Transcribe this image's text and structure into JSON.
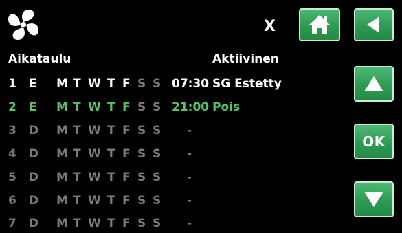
{
  "header": {
    "close_label": "X"
  },
  "icons": {
    "fan": "fan-icon",
    "home": "home-icon",
    "back": "back-arrow-icon",
    "up": "up-arrow-icon",
    "down": "down-arrow-icon"
  },
  "colors": {
    "button_green": "#2f9a53",
    "active_row": "#ffffff",
    "highlight_row": "#56c26a",
    "inactive_row": "#7a7a7a",
    "background": "#000000"
  },
  "schedule": {
    "title": "Aikataulu",
    "active_header": "Aktiivinen",
    "rows": [
      {
        "num": "1",
        "mode": "E",
        "days": [
          "M",
          "T",
          "W",
          "T",
          "F",
          "S",
          "S"
        ],
        "time": "07:30",
        "status": "SG Estetty"
      },
      {
        "num": "2",
        "mode": "E",
        "days": [
          "M",
          "T",
          "W",
          "T",
          "F",
          "S",
          "S"
        ],
        "time": "21:00",
        "status": "Pois"
      },
      {
        "num": "3",
        "mode": "D",
        "days": [
          "M",
          "T",
          "W",
          "T",
          "F",
          "S",
          "S"
        ],
        "dash": "-"
      },
      {
        "num": "4",
        "mode": "D",
        "days": [
          "M",
          "T",
          "W",
          "T",
          "F",
          "S",
          "S"
        ],
        "dash": "-"
      },
      {
        "num": "5",
        "mode": "D",
        "days": [
          "M",
          "T",
          "W",
          "T",
          "F",
          "S",
          "S"
        ],
        "dash": "-"
      },
      {
        "num": "6",
        "mode": "D",
        "days": [
          "M",
          "T",
          "W",
          "T",
          "F",
          "S",
          "S"
        ],
        "dash": "-"
      },
      {
        "num": "7",
        "mode": "D",
        "days": [
          "M",
          "T",
          "W",
          "T",
          "F",
          "S",
          "S"
        ],
        "dash": "-"
      }
    ]
  },
  "buttons": {
    "ok_label": "OK"
  }
}
